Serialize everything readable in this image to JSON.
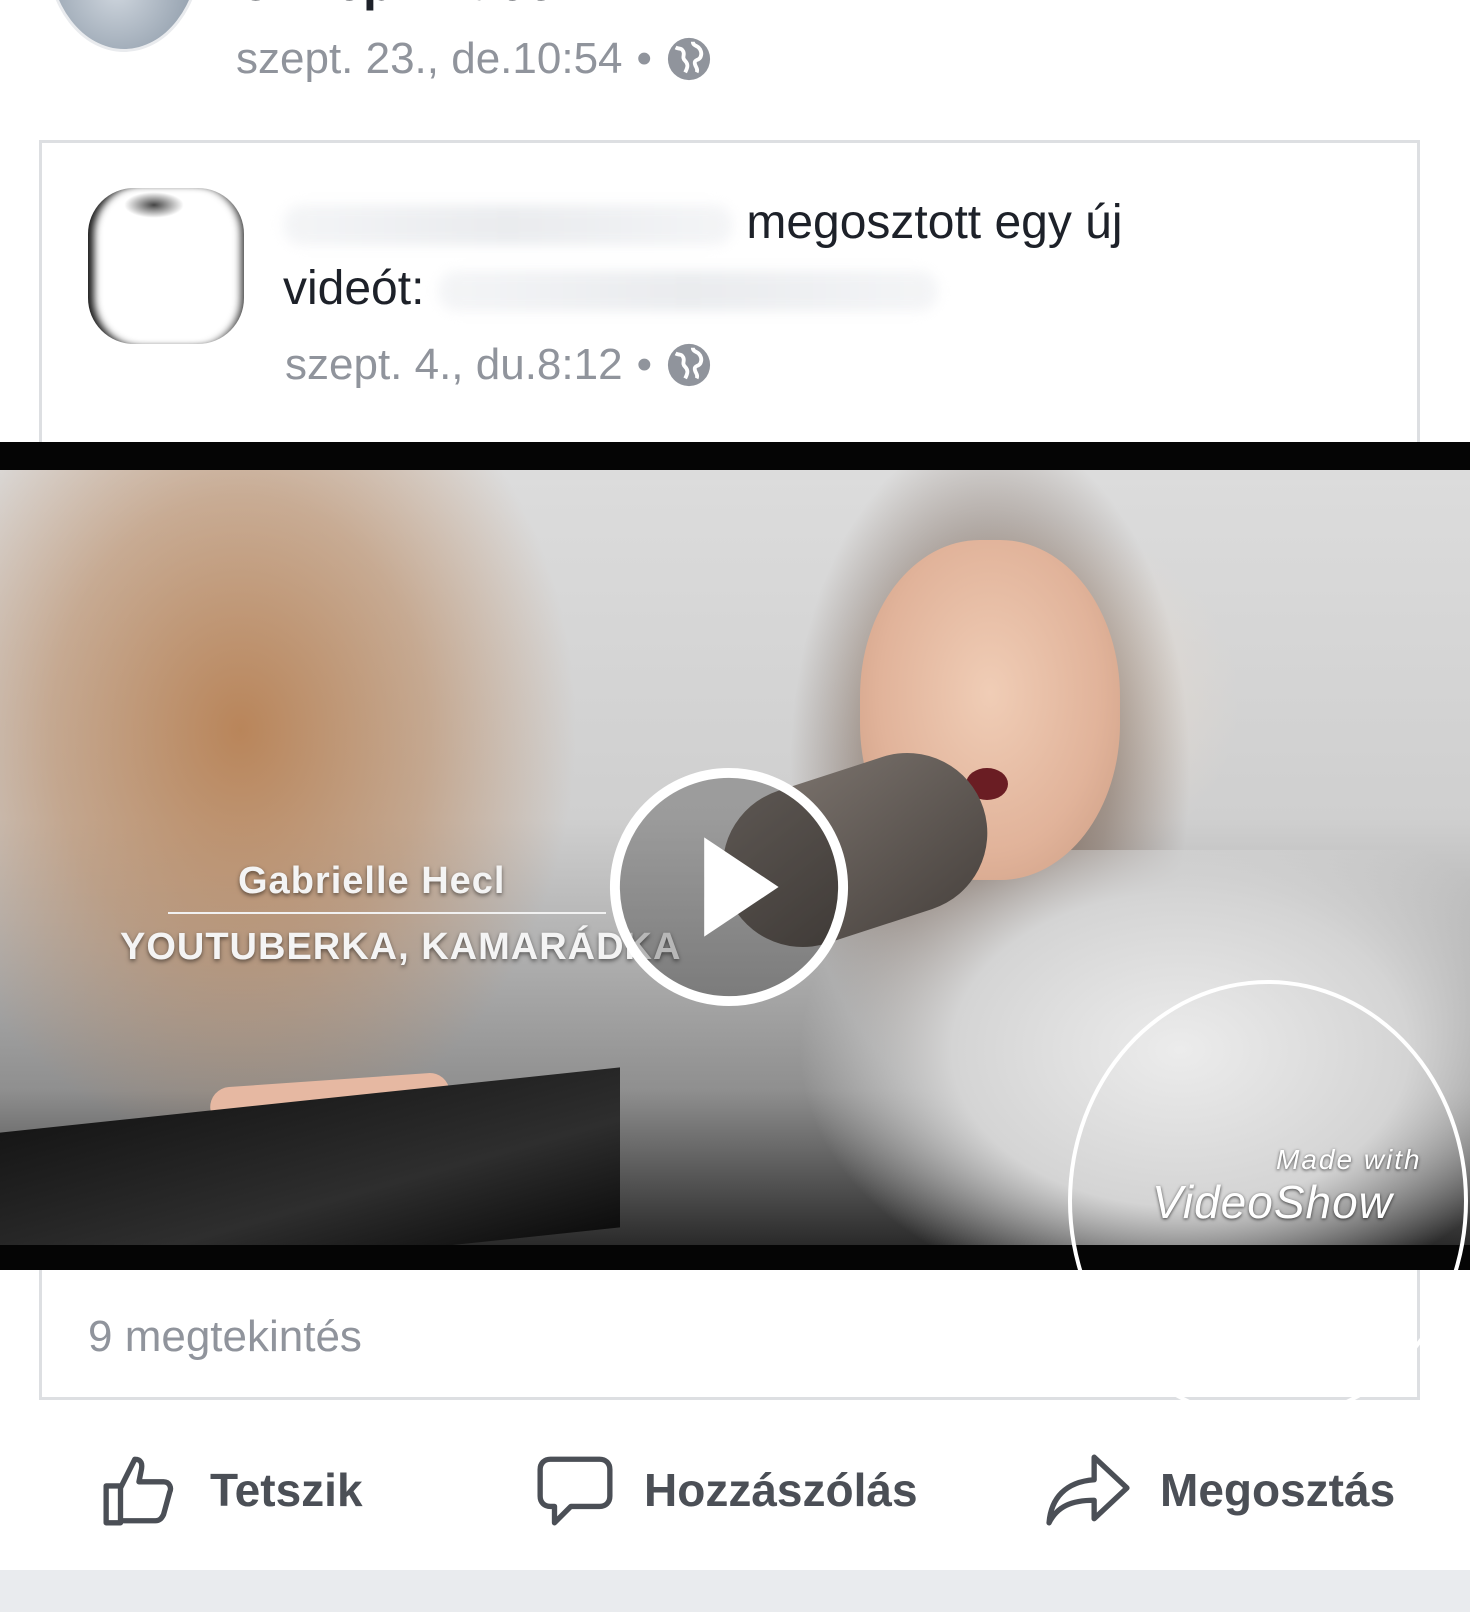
{
  "post": {
    "author_name": "Ünnepi Videók",
    "timestamp": "szept. 23., de.10:54"
  },
  "shared": {
    "headline_text": "megosztott egy új",
    "headline_text2": "videót:",
    "timestamp": "szept. 4., du.8:12"
  },
  "video": {
    "caption_name": "Gabrielle Hecl",
    "caption_role": "YOUTUBERKA, KAMARÁDKA",
    "watermark_top": "Made with",
    "watermark_main": "VideoShow"
  },
  "stats": {
    "views": "9 megtekintés"
  },
  "actions": {
    "like": "Tetszik",
    "comment": "Hozzászólás",
    "share": "Megosztás"
  },
  "icons": [
    "globe-icon",
    "play-icon",
    "like-icon",
    "comment-icon",
    "share-icon"
  ],
  "colors": {
    "text_primary": "#1d2129",
    "text_secondary": "#90949c",
    "action_text": "#4b4f56",
    "border": "#dddfe2"
  }
}
